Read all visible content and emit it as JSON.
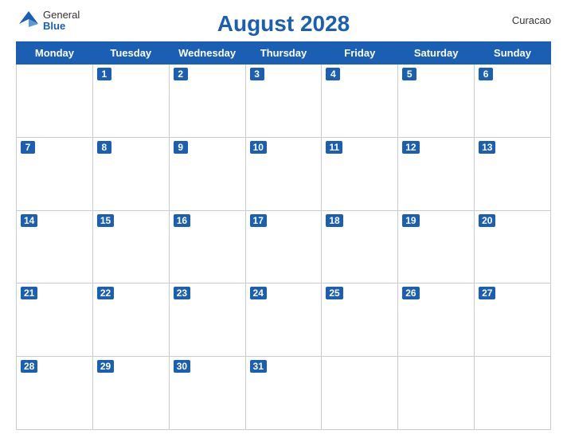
{
  "header": {
    "title": "August 2028",
    "location": "Curacao",
    "logo_general": "General",
    "logo_blue": "Blue"
  },
  "days_of_week": [
    "Monday",
    "Tuesday",
    "Wednesday",
    "Thursday",
    "Friday",
    "Saturday",
    "Sunday"
  ],
  "weeks": [
    [
      null,
      1,
      2,
      3,
      4,
      5,
      6
    ],
    [
      7,
      8,
      9,
      10,
      11,
      12,
      13
    ],
    [
      14,
      15,
      16,
      17,
      18,
      19,
      20
    ],
    [
      21,
      22,
      23,
      24,
      25,
      26,
      27
    ],
    [
      28,
      29,
      30,
      31,
      null,
      null,
      null
    ]
  ]
}
